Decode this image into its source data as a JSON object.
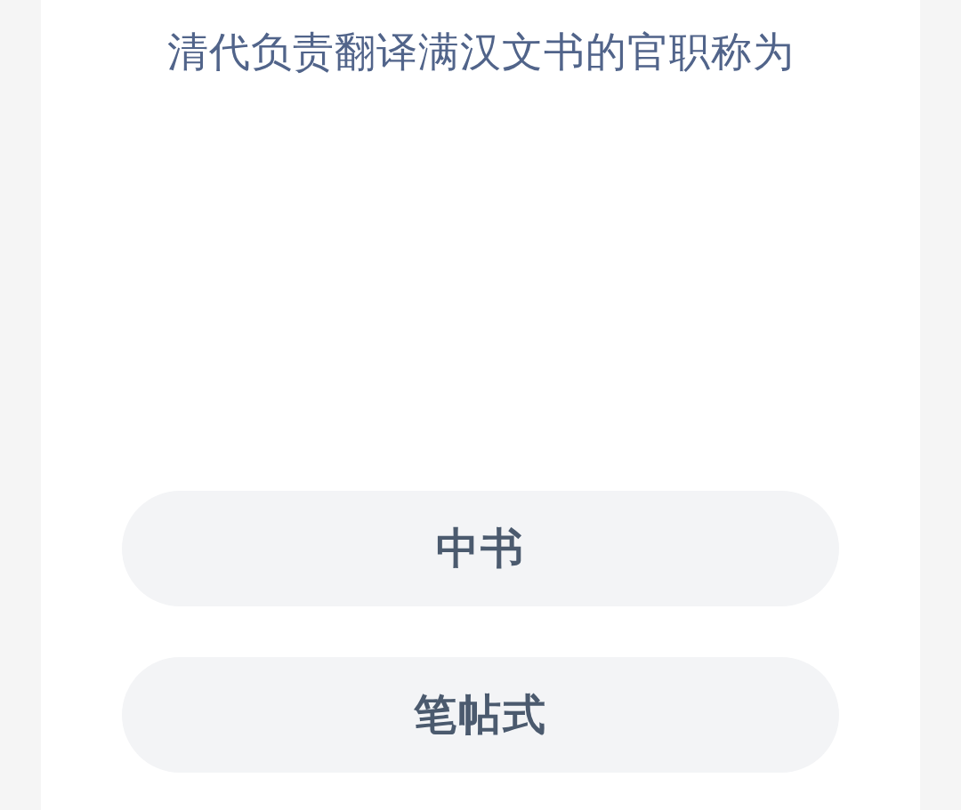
{
  "question": "清代负责翻译满汉文书的官职称为",
  "options": [
    {
      "label": "中书",
      "selected": false
    },
    {
      "label": "笔帖式",
      "selected": false
    }
  ]
}
